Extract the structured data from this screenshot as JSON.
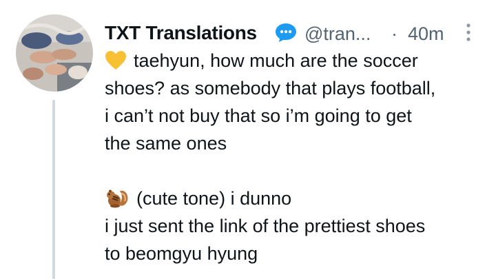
{
  "tweet": {
    "display_name": "TXT Translations",
    "handle": "@tran...",
    "separator": "·",
    "time": "40m",
    "icons": {
      "verified_badge": "speech-bubble-icon",
      "more": "more-vertical-icon",
      "heart_emoji": "yellow-heart-emoji",
      "squirrel_emoji": "chipmunk-emoji"
    },
    "colors": {
      "badge": "#1d9bf0",
      "heart": "#f8c133",
      "muted": "#536471",
      "thread_line": "#cfd9de"
    },
    "paragraph1": {
      "line1": "taehyun, how much are the soccer",
      "line2": "shoes? as somebody that plays football,",
      "line3": "i can’t not buy that so i’m going to get",
      "line4": "the same ones"
    },
    "paragraph2": {
      "line1": "(cute tone) i dunno",
      "line2": "i just sent the link of the prettiest shoes",
      "line3": "to beomgyu hyung"
    }
  }
}
